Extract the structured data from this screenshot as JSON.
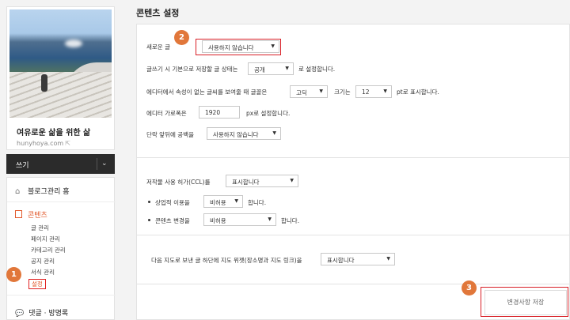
{
  "page_title": "콘텐츠 설정",
  "sidebar": {
    "blog_title": "여유로운 삶을 위한 삶",
    "blog_url": "hunyhoya.com",
    "write_label": "쓰기",
    "home_label": "블로그관리 홈",
    "section_label": "콘텐츠",
    "sub_items": [
      "글 관리",
      "페이지 관리",
      "카테고리 관리",
      "공지 관리",
      "서식 관리",
      "설정"
    ],
    "comments_label": "댓글 · 방명록"
  },
  "settings": {
    "new_post_label": "새로운 글",
    "new_post_value": "사용하지 않습니다",
    "default_state_prefix": "글쓰기 시 기본으로 저장할 글 상태는",
    "default_state_value": "공개",
    "default_state_suffix": "로 설정합니다.",
    "font_prefix": "에디터에서 속성이 없는 글씨를 보여줄 때 글꼴은",
    "font_value": "고딕",
    "size_label": "크기는",
    "size_value": "12",
    "size_suffix": "pt로 표시합니다.",
    "width_label": "에디터 가로폭은",
    "width_value": "1920",
    "width_suffix": "px로 설정합니다.",
    "indent_label": "단락 앞뒤에 공백을",
    "indent_value": "사용하지 않습니다",
    "ccl_label": "저작물 사용 허가(CCL)를",
    "ccl_value": "표시합니다",
    "commercial_label": "상업적 이용을",
    "commercial_value": "비허용",
    "commercial_suffix": "합니다.",
    "modify_label": "콘텐츠 변경을",
    "modify_value": "비허용",
    "modify_suffix": "합니다.",
    "map_label": "다음 지도로 보낸 글 하단에 지도 위젯(장소명과 지도 링크)을",
    "map_value": "표시합니다"
  },
  "save_label": "변경사항 저장",
  "annotations": [
    "1",
    "2",
    "3"
  ]
}
